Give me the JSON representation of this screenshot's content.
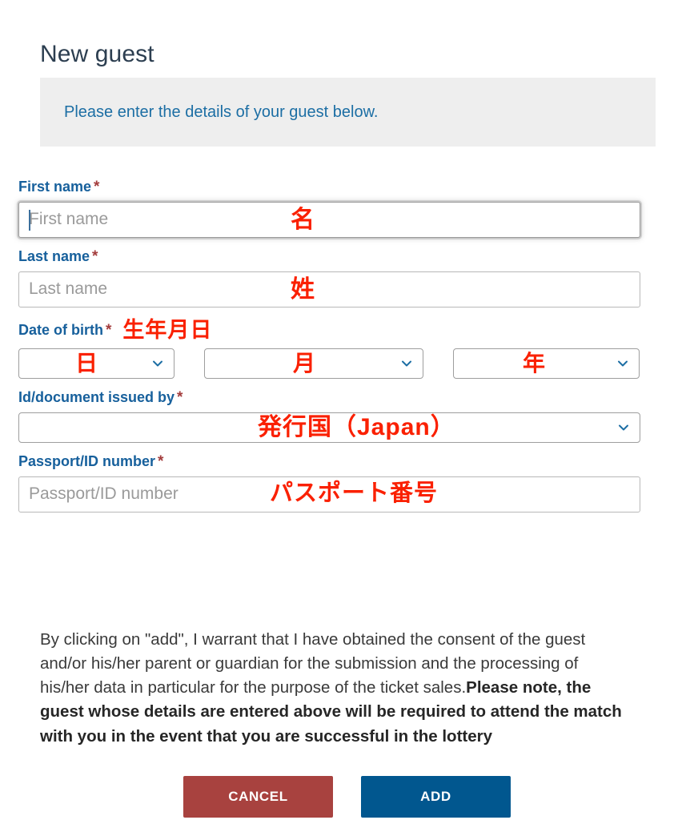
{
  "page": {
    "title": "New guest"
  },
  "banner": {
    "text": "Please enter the details of your guest below."
  },
  "colors": {
    "label_blue": "#17609c",
    "banner_blue": "#1c6ea4",
    "required_star": "#a33c3c",
    "annotation_red": "#fa2000",
    "banner_bg": "#eeeeee",
    "cancel_button": "#a8423f",
    "add_button": "#01578f",
    "title": "#2c3e50"
  },
  "form": {
    "required_marker": "*",
    "fields": [
      {
        "label": "First name",
        "required": true,
        "placeholder": "First name",
        "value": "",
        "annotation": "名",
        "focused": true
      },
      {
        "label": "Last name",
        "required": true,
        "placeholder": "Last name",
        "value": "",
        "annotation": "姓",
        "focused": false
      },
      {
        "label": "Date of birth",
        "required": true,
        "label_annotation": "生年月日",
        "selects": [
          {
            "name": "day",
            "value": "",
            "annotation": "日"
          },
          {
            "name": "month",
            "value": "",
            "annotation": "月"
          },
          {
            "name": "year",
            "value": "",
            "annotation": "年"
          }
        ]
      },
      {
        "label": "Id/document issued by",
        "required": true,
        "value": "",
        "annotation": "発行国（Japan）"
      },
      {
        "label": "Passport/ID number",
        "required": true,
        "placeholder": "Passport/ID number",
        "value": "",
        "annotation": "パスポート番号",
        "focused": false
      }
    ]
  },
  "disclaimer": {
    "normal": "By clicking on \"add\", I warrant that I have obtained the consent of the guest and/or his/her parent or guardian for the submission and the processing of his/her data in particular for the purpose of the ticket sales.",
    "bold": "Please note, the guest whose details are entered above will be required to attend the match with you in the event that you are successful in the lottery"
  },
  "buttons": {
    "cancel": "CANCEL",
    "add": "ADD"
  },
  "icons": {
    "chevron_down": "chevron-down-icon"
  }
}
